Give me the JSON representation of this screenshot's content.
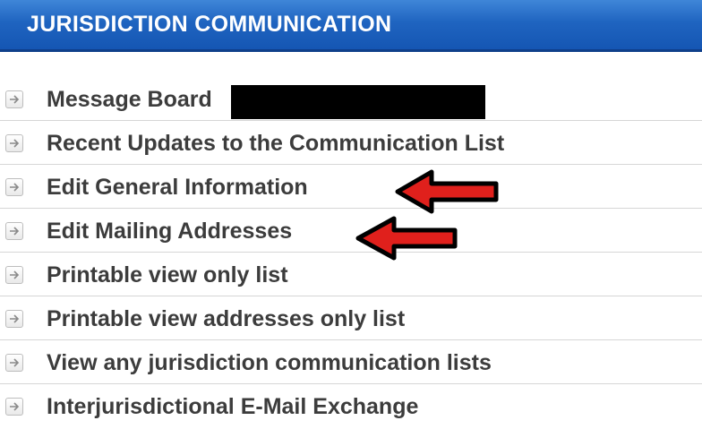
{
  "header": {
    "title": "JURISDICTION COMMUNICATION"
  },
  "menu": {
    "items": [
      {
        "label": "Message Board"
      },
      {
        "label": "Recent Updates to the Communication List"
      },
      {
        "label": "Edit General Information"
      },
      {
        "label": "Edit Mailing Addresses"
      },
      {
        "label": "Printable view only list"
      },
      {
        "label": "Printable view addresses only list"
      },
      {
        "label": "View any jurisdiction communication lists"
      },
      {
        "label": "Interjurisdictional E-Mail Exchange"
      }
    ]
  },
  "colors": {
    "header_blue": "#1f64c0",
    "annotation_red": "#e0201c",
    "text": "#3c3c3c"
  },
  "icons": {
    "menu_item": "arrow-right-icon",
    "annotation": "red-arrow-icon"
  }
}
